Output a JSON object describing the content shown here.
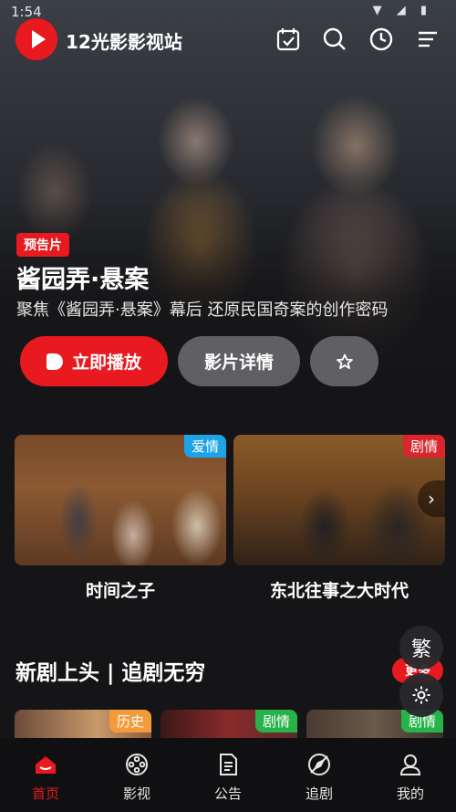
{
  "status": {
    "time": "1:54",
    "icons": "▼ ◢ ▮"
  },
  "app": {
    "title": "12光影影视站"
  },
  "hero": {
    "badge": "预告片",
    "title": "酱园弄·悬案",
    "subtitle": "聚焦《酱园弄·悬案》幕后 还原民国奇案的创作密码",
    "play_label": "立即播放",
    "detail_label": "影片详情"
  },
  "cards": [
    {
      "title": "时间之子",
      "tag": "爱情",
      "tag_color": "#1ea4e6"
    },
    {
      "title": "东北往事之大时代",
      "tag": "剧情",
      "tag_color": "#d9262c"
    }
  ],
  "section": {
    "title": "新剧上头 | 追剧无穷",
    "more_label": "更多"
  },
  "floating": {
    "traditional_label": "繁"
  },
  "mini_cards": [
    {
      "tag": "历史",
      "tag_color": "#f39a3a"
    },
    {
      "tag": "剧情",
      "tag_color": "#27b24a"
    },
    {
      "tag": "剧情",
      "tag_color": "#27b24a"
    }
  ],
  "nav": [
    {
      "label": "首页",
      "icon": "home-icon",
      "active": true
    },
    {
      "label": "影视",
      "icon": "film-reel-icon",
      "active": false
    },
    {
      "label": "公告",
      "icon": "document-icon",
      "active": false
    },
    {
      "label": "追剧",
      "icon": "compass-icon",
      "active": false
    },
    {
      "label": "我的",
      "icon": "user-icon",
      "active": false
    }
  ],
  "colors": {
    "accent": "#e8191f",
    "background": "#151517"
  }
}
